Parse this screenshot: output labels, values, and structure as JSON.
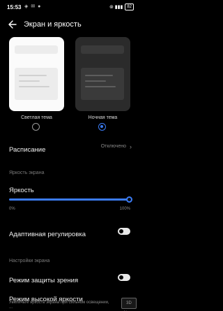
{
  "status_bar": {
    "time": "15:53",
    "left_icons": "◈ ✉ ●",
    "right_icons": "⊚ ▮▮▮",
    "battery": "82"
  },
  "header": {
    "title": "Экран и яркость"
  },
  "themes": {
    "light_label": "Светлая тема",
    "dark_label": "Ночная тема",
    "selected": "dark"
  },
  "schedule": {
    "label": "Расписание",
    "value": "Отключено"
  },
  "brightness_section": {
    "header": "Яркость экрана",
    "label": "Яркость",
    "min_label": "0%",
    "max_label": "100%",
    "value_percent": 100
  },
  "adaptive": {
    "label": "Адаптивная регулировка",
    "enabled": false
  },
  "screen_section": {
    "header": "Настройки экрана"
  },
  "eye_protection": {
    "label": "Режим защиты зрения",
    "enabled": false
  },
  "high_brightness": {
    "label": "Режим высокой яркости",
    "subtext": "Увеличьте яркость экрана при сильном освещении, ..."
  },
  "watermark": "3D News"
}
